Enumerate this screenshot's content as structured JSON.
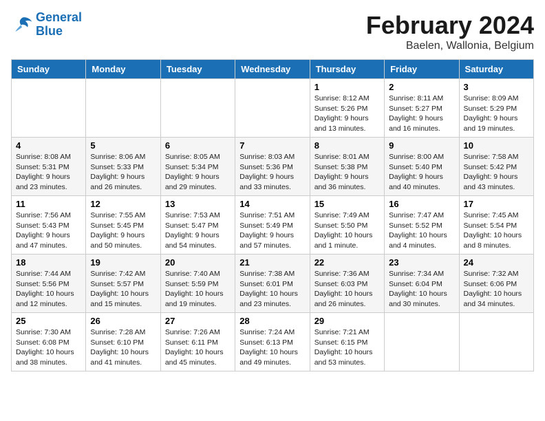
{
  "logo": {
    "line1": "General",
    "line2": "Blue"
  },
  "title": "February 2024",
  "location": "Baelen, Wallonia, Belgium",
  "weekdays": [
    "Sunday",
    "Monday",
    "Tuesday",
    "Wednesday",
    "Thursday",
    "Friday",
    "Saturday"
  ],
  "weeks": [
    [
      {
        "day": "",
        "info": ""
      },
      {
        "day": "",
        "info": ""
      },
      {
        "day": "",
        "info": ""
      },
      {
        "day": "",
        "info": ""
      },
      {
        "day": "1",
        "info": "Sunrise: 8:12 AM\nSunset: 5:26 PM\nDaylight: 9 hours\nand 13 minutes."
      },
      {
        "day": "2",
        "info": "Sunrise: 8:11 AM\nSunset: 5:27 PM\nDaylight: 9 hours\nand 16 minutes."
      },
      {
        "day": "3",
        "info": "Sunrise: 8:09 AM\nSunset: 5:29 PM\nDaylight: 9 hours\nand 19 minutes."
      }
    ],
    [
      {
        "day": "4",
        "info": "Sunrise: 8:08 AM\nSunset: 5:31 PM\nDaylight: 9 hours\nand 23 minutes."
      },
      {
        "day": "5",
        "info": "Sunrise: 8:06 AM\nSunset: 5:33 PM\nDaylight: 9 hours\nand 26 minutes."
      },
      {
        "day": "6",
        "info": "Sunrise: 8:05 AM\nSunset: 5:34 PM\nDaylight: 9 hours\nand 29 minutes."
      },
      {
        "day": "7",
        "info": "Sunrise: 8:03 AM\nSunset: 5:36 PM\nDaylight: 9 hours\nand 33 minutes."
      },
      {
        "day": "8",
        "info": "Sunrise: 8:01 AM\nSunset: 5:38 PM\nDaylight: 9 hours\nand 36 minutes."
      },
      {
        "day": "9",
        "info": "Sunrise: 8:00 AM\nSunset: 5:40 PM\nDaylight: 9 hours\nand 40 minutes."
      },
      {
        "day": "10",
        "info": "Sunrise: 7:58 AM\nSunset: 5:42 PM\nDaylight: 9 hours\nand 43 minutes."
      }
    ],
    [
      {
        "day": "11",
        "info": "Sunrise: 7:56 AM\nSunset: 5:43 PM\nDaylight: 9 hours\nand 47 minutes."
      },
      {
        "day": "12",
        "info": "Sunrise: 7:55 AM\nSunset: 5:45 PM\nDaylight: 9 hours\nand 50 minutes."
      },
      {
        "day": "13",
        "info": "Sunrise: 7:53 AM\nSunset: 5:47 PM\nDaylight: 9 hours\nand 54 minutes."
      },
      {
        "day": "14",
        "info": "Sunrise: 7:51 AM\nSunset: 5:49 PM\nDaylight: 9 hours\nand 57 minutes."
      },
      {
        "day": "15",
        "info": "Sunrise: 7:49 AM\nSunset: 5:50 PM\nDaylight: 10 hours\nand 1 minute."
      },
      {
        "day": "16",
        "info": "Sunrise: 7:47 AM\nSunset: 5:52 PM\nDaylight: 10 hours\nand 4 minutes."
      },
      {
        "day": "17",
        "info": "Sunrise: 7:45 AM\nSunset: 5:54 PM\nDaylight: 10 hours\nand 8 minutes."
      }
    ],
    [
      {
        "day": "18",
        "info": "Sunrise: 7:44 AM\nSunset: 5:56 PM\nDaylight: 10 hours\nand 12 minutes."
      },
      {
        "day": "19",
        "info": "Sunrise: 7:42 AM\nSunset: 5:57 PM\nDaylight: 10 hours\nand 15 minutes."
      },
      {
        "day": "20",
        "info": "Sunrise: 7:40 AM\nSunset: 5:59 PM\nDaylight: 10 hours\nand 19 minutes."
      },
      {
        "day": "21",
        "info": "Sunrise: 7:38 AM\nSunset: 6:01 PM\nDaylight: 10 hours\nand 23 minutes."
      },
      {
        "day": "22",
        "info": "Sunrise: 7:36 AM\nSunset: 6:03 PM\nDaylight: 10 hours\nand 26 minutes."
      },
      {
        "day": "23",
        "info": "Sunrise: 7:34 AM\nSunset: 6:04 PM\nDaylight: 10 hours\nand 30 minutes."
      },
      {
        "day": "24",
        "info": "Sunrise: 7:32 AM\nSunset: 6:06 PM\nDaylight: 10 hours\nand 34 minutes."
      }
    ],
    [
      {
        "day": "25",
        "info": "Sunrise: 7:30 AM\nSunset: 6:08 PM\nDaylight: 10 hours\nand 38 minutes."
      },
      {
        "day": "26",
        "info": "Sunrise: 7:28 AM\nSunset: 6:10 PM\nDaylight: 10 hours\nand 41 minutes."
      },
      {
        "day": "27",
        "info": "Sunrise: 7:26 AM\nSunset: 6:11 PM\nDaylight: 10 hours\nand 45 minutes."
      },
      {
        "day": "28",
        "info": "Sunrise: 7:24 AM\nSunset: 6:13 PM\nDaylight: 10 hours\nand 49 minutes."
      },
      {
        "day": "29",
        "info": "Sunrise: 7:21 AM\nSunset: 6:15 PM\nDaylight: 10 hours\nand 53 minutes."
      },
      {
        "day": "",
        "info": ""
      },
      {
        "day": "",
        "info": ""
      }
    ]
  ]
}
